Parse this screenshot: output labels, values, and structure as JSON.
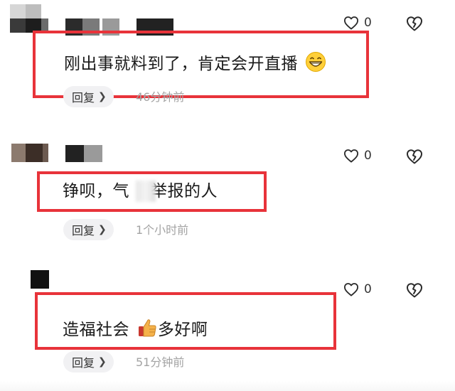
{
  "comments": [
    {
      "text": "刚出事就料到了，肯定会开直播",
      "emoji_icon": "grinning-face-emoji",
      "likes": "0",
      "reply_label": "回复",
      "time": "46分钟前"
    },
    {
      "text": "铮呗，气",
      "text_after_blur": "举报的人",
      "likes": "0",
      "reply_label": "回复",
      "time": "1个小时前"
    },
    {
      "text": "造福社会",
      "emoji_icon": "thumbs-up-emoji",
      "text_after_emoji": "多好啊",
      "likes": "0",
      "reply_label": "回复",
      "time": "51分钟前"
    }
  ],
  "icons": {
    "like": "heart-outline-icon",
    "dislike": "broken-heart-icon",
    "chevron": "chevron-right-icon"
  },
  "colors": {
    "highlight_box": "#e8333a",
    "reply_bg": "#f1f1f3",
    "timestamp": "#a3a3a3"
  }
}
